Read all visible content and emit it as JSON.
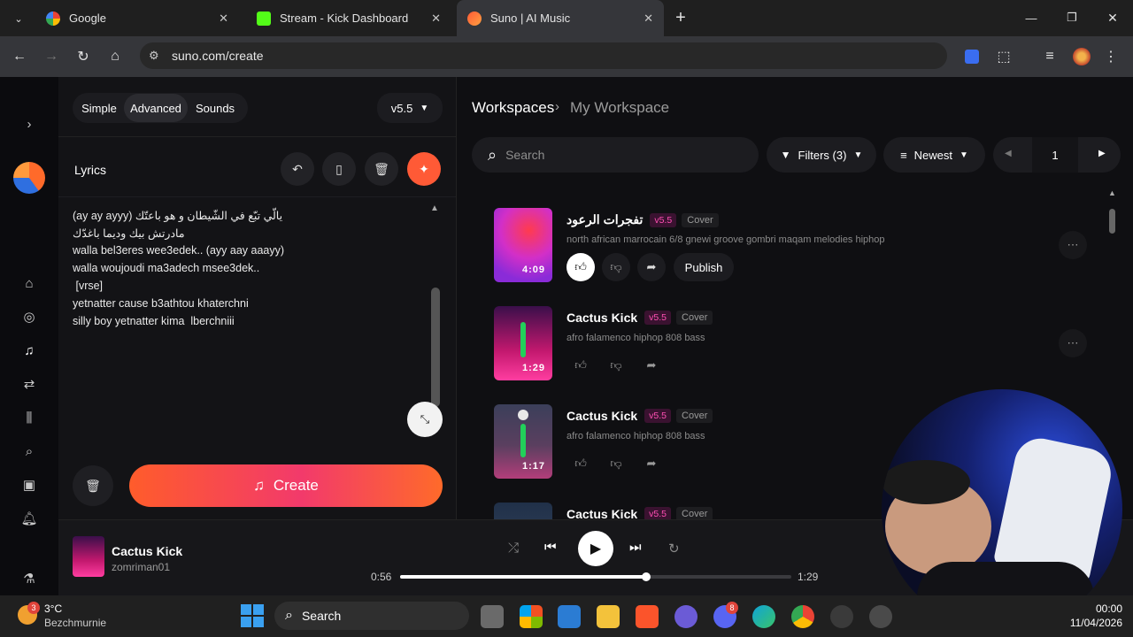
{
  "browser": {
    "tabs": [
      {
        "label": "Google",
        "active": false
      },
      {
        "label": "Stream - Kick Dashboard",
        "active": false
      },
      {
        "label": "Suno | AI Music",
        "active": true
      }
    ],
    "url": "suno.com/create"
  },
  "create_panel": {
    "modes": [
      "Simple",
      "Advanced",
      "Sounds"
    ],
    "active_mode": "Advanced",
    "model_version": "v5.5",
    "lyrics_label": "Lyrics",
    "lyrics_lines": [
      "(ay ay ayyy) يالّي تبّع في الشّيطان و هو باعتّك",
      "مادرتش بيك وديما باغدّك",
      "walla bel3eres wee3edek.. (ayy aay aaayy)",
      "walla woujoudi ma3adech msee3dek..",
      " [vrse]",
      "yetnatter cause b3athtou khaterchni",
      "silly boy yetnatter kima  lberchniii"
    ],
    "create_label": "Create"
  },
  "workspace": {
    "breadcrumb_root": "Workspaces",
    "breadcrumb_current": "My Workspace",
    "search_placeholder": "Search",
    "filters_label": "Filters (3)",
    "sort_label": "Newest",
    "page_number": "1",
    "songs": [
      {
        "title": "تفجرات الرعود",
        "version": "v5.5",
        "tag": "Cover",
        "desc": "north african marrocain 6/8 gnewi groove gombri maqam melodies hiphop",
        "duration": "4:09",
        "publish_label": "Publish"
      },
      {
        "title": "Cactus Kick",
        "version": "v5.5",
        "tag": "Cover",
        "desc": "afro falamenco hiphop 808 bass",
        "duration": "1:29"
      },
      {
        "title": "Cactus Kick",
        "version": "v5.5",
        "tag": "Cover",
        "desc": "afro falamenco hiphop 808 bass",
        "duration": "1:17"
      },
      {
        "title": "Cactus Kick",
        "version": "v5.5",
        "tag": "Cover"
      }
    ]
  },
  "player": {
    "track_title": "Cactus Kick",
    "artist": "zomriman01",
    "elapsed": "0:56",
    "total": "1:29",
    "progress": 0.63
  },
  "taskbar": {
    "weather_temp": "3°C",
    "weather_location": "Bezchmurnie",
    "weather_badge": "3",
    "search_label": "Search",
    "discord_badge": "8",
    "time": "00:00",
    "date": "11/04/2026"
  },
  "colors": {
    "accent": "#ff5a36",
    "version_badge": "#ff4fb3"
  }
}
